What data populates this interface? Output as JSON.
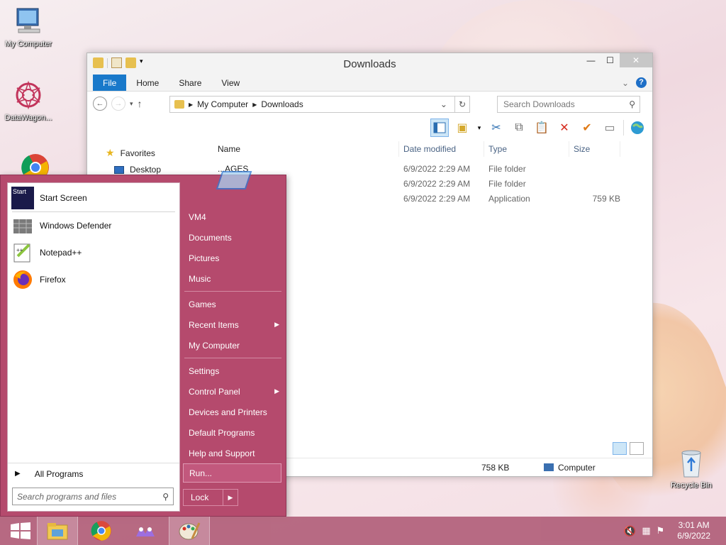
{
  "desktop": {
    "icons": [
      {
        "label": "My Computer"
      },
      {
        "label": "DataWagon..."
      },
      {
        "label": "Recycle Bin"
      }
    ]
  },
  "explorer": {
    "title": "Downloads",
    "tabs": [
      "File",
      "Home",
      "Share",
      "View"
    ],
    "address": {
      "root": "My Computer",
      "current": "Downloads"
    },
    "search_placeholder": "Search Downloads",
    "nav": {
      "favorites": "Favorites",
      "desktop": "Desktop"
    },
    "columns": {
      "name": "Name",
      "date": "Date modified",
      "type": "Type",
      "size": "Size"
    },
    "files": [
      {
        "name": "...AGES",
        "date": "6/9/2022 2:29 AM",
        "type": "File folder",
        "size": ""
      },
      {
        "name": "",
        "date": "6/9/2022 2:29 AM",
        "type": "File folder",
        "size": ""
      },
      {
        "name": "",
        "date": "6/9/2022 2:29 AM",
        "type": "Application",
        "size": "759 KB"
      }
    ],
    "status": {
      "size": "758 KB",
      "location": "Computer"
    }
  },
  "startmenu": {
    "programs": [
      "Start Screen",
      "Windows Defender",
      "Notepad++",
      "Firefox"
    ],
    "all_programs": "All Programs",
    "search_placeholder": "Search programs and files",
    "right_group1": [
      "VM4",
      "Documents",
      "Pictures",
      "Music"
    ],
    "right_group2": [
      {
        "label": "Games"
      },
      {
        "label": "Recent Items",
        "arrow": true
      },
      {
        "label": "My Computer"
      }
    ],
    "right_group3": [
      {
        "label": "Settings"
      },
      {
        "label": "Control Panel",
        "arrow": true
      },
      {
        "label": "Devices and Printers"
      },
      {
        "label": "Default Programs"
      },
      {
        "label": "Help and Support"
      }
    ],
    "run": "Run...",
    "lock": "Lock",
    "start_icon_text": "Start"
  },
  "taskbar": {
    "time": "3:01 AM",
    "date": "6/9/2022"
  },
  "colors": {
    "accent": "#1979ca",
    "startmenu": "#b54a6d",
    "taskbar": "#b5667f"
  }
}
